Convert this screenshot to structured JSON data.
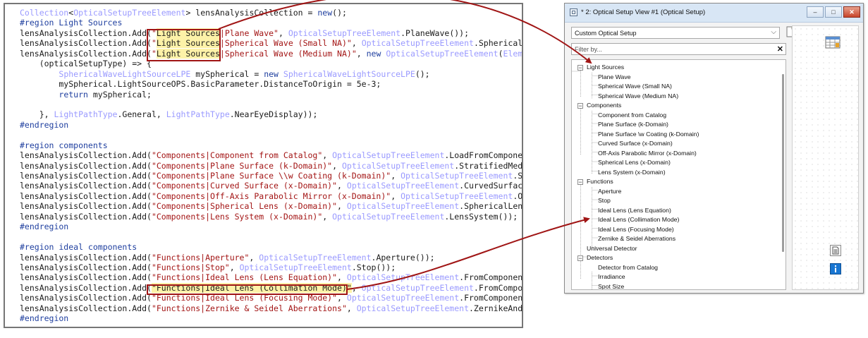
{
  "code": {
    "lines": [
      [
        [
          "t",
          "Collection"
        ],
        [
          "p",
          "<"
        ],
        [
          "t",
          "OpticalSetupTreeElement"
        ],
        [
          "p",
          "> lensAnalysisCollection = "
        ],
        [
          "k",
          "new"
        ],
        [
          "p",
          "();"
        ]
      ],
      [
        [
          "k",
          "#region Light Sources"
        ]
      ],
      [
        [
          "p",
          "lensAnalysisCollection.Add("
        ],
        [
          "s",
          "\""
        ],
        [
          "hl",
          "Light Sources"
        ],
        [
          "s",
          "|Plane Wave\""
        ],
        [
          "p",
          ", "
        ],
        [
          "t",
          "OpticalSetupTreeElement"
        ],
        [
          "p",
          ".PlaneWave());"
        ]
      ],
      [
        [
          "p",
          "lensAnalysisCollection.Add("
        ],
        [
          "s",
          "\""
        ],
        [
          "hl",
          "Light Sources"
        ],
        [
          "s",
          "|Spherical Wave (Small NA)\""
        ],
        [
          "p",
          ", "
        ],
        [
          "t",
          "OpticalSetupTreeElement"
        ],
        [
          "p",
          ".SphericalWav"
        ]
      ],
      [
        [
          "p",
          "lensAnalysisCollection.Add("
        ],
        [
          "s",
          "\""
        ],
        [
          "hl",
          "Light Sources"
        ],
        [
          "s",
          "|Spherical Wave (Medium NA)\""
        ],
        [
          "p",
          ", "
        ],
        [
          "k",
          "new "
        ],
        [
          "t",
          "OpticalSetupTreeElement"
        ],
        [
          "p",
          "("
        ],
        [
          "t",
          "Element"
        ]
      ],
      [
        [
          "p",
          "    (opticalSetupType) => {"
        ]
      ],
      [
        [
          "p",
          "        "
        ],
        [
          "t",
          "SphericalWaveLightSourceLPE"
        ],
        [
          "p",
          " mySpherical = "
        ],
        [
          "k",
          "new "
        ],
        [
          "t",
          "SphericalWaveLightSourceLPE"
        ],
        [
          "p",
          "();"
        ]
      ],
      [
        [
          "p",
          "        mySpherical.LightSourceOPS.BasicParameter.DistanceToOrigin = 5e-3;"
        ]
      ],
      [
        [
          "p",
          "        "
        ],
        [
          "k",
          "return"
        ],
        [
          "p",
          " mySpherical;"
        ]
      ],
      [
        [
          "p",
          ""
        ]
      ],
      [
        [
          "p",
          "    }, "
        ],
        [
          "t",
          "LightPathType"
        ],
        [
          "p",
          ".General, "
        ],
        [
          "t",
          "LightPathType"
        ],
        [
          "p",
          ".NearEyeDisplay));"
        ]
      ],
      [
        [
          "k",
          "#endregion"
        ]
      ],
      [
        [
          "p",
          ""
        ]
      ],
      [
        [
          "k",
          "#region components"
        ]
      ],
      [
        [
          "p",
          "lensAnalysisCollection.Add("
        ],
        [
          "s",
          "\"Components|Component from Catalog\""
        ],
        [
          "p",
          ", "
        ],
        [
          "t",
          "OpticalSetupTreeElement"
        ],
        [
          "p",
          ".LoadFromComponent("
        ]
      ],
      [
        [
          "p",
          "lensAnalysisCollection.Add("
        ],
        [
          "s",
          "\"Components|Plane Surface (k-Domain)\""
        ],
        [
          "p",
          ", "
        ],
        [
          "t",
          "OpticalSetupTreeElement"
        ],
        [
          "p",
          ".StratifiedMedia("
        ]
      ],
      [
        [
          "p",
          "lensAnalysisCollection.Add("
        ],
        [
          "s",
          "\"Components|Plane Surface \\\\w Coating (k-Domain)\""
        ],
        [
          "p",
          ", "
        ],
        [
          "t",
          "OpticalSetupTreeElement"
        ],
        [
          "p",
          ".Stra"
        ]
      ],
      [
        [
          "p",
          "lensAnalysisCollection.Add("
        ],
        [
          "s",
          "\"Components|Curved Surface (x-Domain)\""
        ],
        [
          "p",
          ", "
        ],
        [
          "t",
          "OpticalSetupTreeElement"
        ],
        [
          "p",
          ".CurvedSurface("
        ]
      ],
      [
        [
          "p",
          "lensAnalysisCollection.Add("
        ],
        [
          "s",
          "\"Components|Off-Axis Parabolic Mirror (x-Domain)\""
        ],
        [
          "p",
          ", "
        ],
        [
          "t",
          "OpticalSetupTreeElement"
        ],
        [
          "p",
          ".OffA"
        ]
      ],
      [
        [
          "p",
          "lensAnalysisCollection.Add("
        ],
        [
          "s",
          "\"Components|Spherical Lens (x-Domain)\""
        ],
        [
          "p",
          ", "
        ],
        [
          "t",
          "OpticalSetupTreeElement"
        ],
        [
          "p",
          ".SphericalLens("
        ]
      ],
      [
        [
          "p",
          "lensAnalysisCollection.Add("
        ],
        [
          "s",
          "\"Components|Lens System (x-Domain)\""
        ],
        [
          "p",
          ", "
        ],
        [
          "t",
          "OpticalSetupTreeElement"
        ],
        [
          "p",
          ".LensSystem());"
        ]
      ],
      [
        [
          "k",
          "#endregion"
        ]
      ],
      [
        [
          "p",
          ""
        ]
      ],
      [
        [
          "k",
          "#region ideal components"
        ]
      ],
      [
        [
          "p",
          "lensAnalysisCollection.Add("
        ],
        [
          "s",
          "\"Functions|Aperture\""
        ],
        [
          "p",
          ", "
        ],
        [
          "t",
          "OpticalSetupTreeElement"
        ],
        [
          "p",
          ".Aperture());"
        ]
      ],
      [
        [
          "p",
          "lensAnalysisCollection.Add("
        ],
        [
          "s",
          "\"Functions|Stop\""
        ],
        [
          "p",
          ", "
        ],
        [
          "t",
          "OpticalSetupTreeElement"
        ],
        [
          "p",
          ".Stop());"
        ]
      ],
      [
        [
          "p",
          "lensAnalysisCollection.Add("
        ],
        [
          "s",
          "\"Functions|Ideal Lens (Lens Equation)\""
        ],
        [
          "p",
          ", "
        ],
        [
          "t",
          "OpticalSetupTreeElement"
        ],
        [
          "p",
          ".FromComponentCa"
        ]
      ],
      [
        [
          "p",
          "lensAnalysisCollection.Add("
        ],
        [
          "hl",
          "\"Functions|Ideal Lens (Collimation Mode)\""
        ],
        [
          "p",
          ", "
        ],
        [
          "t",
          "OpticalSetupTreeElement"
        ],
        [
          "p",
          ".FromCompone"
        ]
      ],
      [
        [
          "p",
          "lensAnalysisCollection.Add("
        ],
        [
          "s",
          "\"Functions|Ideal Lens (Focusing Mode)\""
        ],
        [
          "p",
          ", "
        ],
        [
          "t",
          "OpticalSetupTreeElement"
        ],
        [
          "p",
          ".FromComponentCa"
        ]
      ],
      [
        [
          "p",
          "lensAnalysisCollection.Add("
        ],
        [
          "s",
          "\"Functions|Zernike & Seidel Aberrations\""
        ],
        [
          "p",
          ", "
        ],
        [
          "t",
          "OpticalSetupTreeElement"
        ],
        [
          "p",
          ".ZernikeAndSe"
        ]
      ],
      [
        [
          "k",
          "#endregion"
        ]
      ]
    ]
  },
  "window": {
    "title": "* 2: Optical Setup View #1 (Optical Setup)",
    "minimize_glyph": "–",
    "maximize_glyph": "□",
    "close_glyph": "✕",
    "setup_select": "Custom Optical Setup",
    "combo_arrow": "⌵",
    "filter_placeholder": "Filter by...",
    "filter_clear": "✕"
  },
  "tree": {
    "rows": [
      {
        "kind": "cat",
        "label": "Light Sources",
        "expander": "−"
      },
      {
        "kind": "leaf",
        "label": "Plane Wave"
      },
      {
        "kind": "leaf",
        "label": "Spherical Wave (Small NA)"
      },
      {
        "kind": "leaf",
        "label": "Spherical Wave (Medium NA)"
      },
      {
        "kind": "cat",
        "label": "Components",
        "expander": "−"
      },
      {
        "kind": "leaf",
        "label": "Component from Catalog"
      },
      {
        "kind": "leaf",
        "label": "Plane Surface (k-Domain)"
      },
      {
        "kind": "leaf",
        "label": "Plane Surface \\w Coating (k-Domain)"
      },
      {
        "kind": "leaf",
        "label": "Curved Surface (x-Domain)"
      },
      {
        "kind": "leaf",
        "label": "Off-Axis Parabolic Mirror (x-Domain)"
      },
      {
        "kind": "leaf",
        "label": "Spherical Lens (x-Domain)"
      },
      {
        "kind": "leaf",
        "label": "Lens System (x-Domain)"
      },
      {
        "kind": "cat",
        "label": "Functions",
        "expander": "−"
      },
      {
        "kind": "leaf",
        "label": "Aperture"
      },
      {
        "kind": "leaf",
        "label": "Stop"
      },
      {
        "kind": "leaf",
        "label": "Ideal Lens (Lens Equation)"
      },
      {
        "kind": "leaf",
        "label": "Ideal Lens (Collimation Mode)"
      },
      {
        "kind": "leaf",
        "label": "Ideal Lens (Focusing Mode)"
      },
      {
        "kind": "leaf",
        "label": "Zernike & Seidel Aberrations"
      },
      {
        "kind": "top",
        "label": "Universal Detector"
      },
      {
        "kind": "cat",
        "label": "Detectors",
        "expander": "−"
      },
      {
        "kind": "leaf",
        "label": "Detector from Catalog"
      },
      {
        "kind": "leaf",
        "label": "Irradiance"
      },
      {
        "kind": "leaf",
        "label": "Spot Size"
      }
    ]
  },
  "colors": {
    "highlight_border": "#a01515",
    "highlight_fill": "#fdf2a8",
    "keyword": "#1f3f9f",
    "type": "#9a9aff",
    "string": "#a31515",
    "info_icon": "#1976d2"
  },
  "icons": [
    "window-app-icon",
    "new-document-icon",
    "table-grid-icon",
    "document-icon",
    "info-icon",
    "close-icon",
    "chevron-down-icon"
  ]
}
